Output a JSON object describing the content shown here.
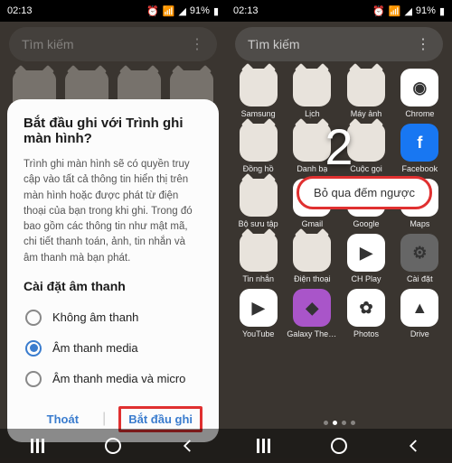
{
  "status": {
    "time": "02:13",
    "battery_pct": "91%"
  },
  "search": {
    "placeholder": "Tìm kiếm"
  },
  "left": {
    "bg_apps": [
      "Samsung",
      "Lịch",
      "Máy ảnh",
      "Chrome"
    ],
    "dialog": {
      "title": "Bắt đầu ghi với Trình ghi màn hình?",
      "body": "Trình ghi màn hình sẽ có quyền truy cập vào tất cả thông tin hiển thị trên màn hình hoặc được phát từ điện thoại của bạn trong khi ghi. Trong đó bao gồm các thông tin như mật mã, chi tiết thanh toán, ảnh, tin nhắn và âm thanh mà bạn phát.",
      "section": "Cài đặt âm thanh",
      "options": [
        {
          "label": "Không âm thanh",
          "selected": false
        },
        {
          "label": "Âm thanh media",
          "selected": true
        },
        {
          "label": "Âm thanh media và micro",
          "selected": false
        }
      ],
      "cancel": "Thoát",
      "confirm": "Bắt đầu ghi"
    }
  },
  "right": {
    "countdown": "2",
    "skip": "Bỏ qua đếm ngược",
    "apps": [
      {
        "label": "Samsung",
        "k": "cat"
      },
      {
        "label": "Lịch",
        "k": "cat"
      },
      {
        "label": "Máy ảnh",
        "k": "cat"
      },
      {
        "label": "Chrome",
        "k": "ic-chrome"
      },
      {
        "label": "Đồng hồ",
        "k": "cat"
      },
      {
        "label": "Danh bạ",
        "k": "cat"
      },
      {
        "label": "Cuộc gọi",
        "k": "cat"
      },
      {
        "label": "Facebook",
        "k": "ic-fb"
      },
      {
        "label": "Bộ sưu tập",
        "k": "cat"
      },
      {
        "label": "Gmail",
        "k": "ic-gmail"
      },
      {
        "label": "Google",
        "k": "ic-google"
      },
      {
        "label": "Maps",
        "k": "ic-maps"
      },
      {
        "label": "Tin nhắn",
        "k": "cat"
      },
      {
        "label": "Điện thoại",
        "k": "cat"
      },
      {
        "label": "CH Play",
        "k": "ic-play"
      },
      {
        "label": "Cài đặt",
        "k": "ic-settings"
      },
      {
        "label": "YouTube",
        "k": "ic-yt"
      },
      {
        "label": "Galaxy Themes",
        "k": "ic-themes"
      },
      {
        "label": "Photos",
        "k": "ic-photos"
      },
      {
        "label": "Drive",
        "k": "ic-drive"
      }
    ]
  }
}
